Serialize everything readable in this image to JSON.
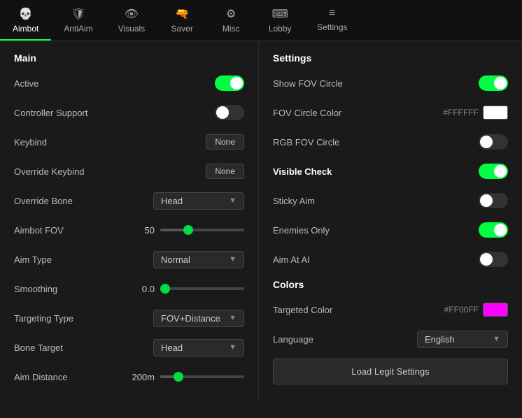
{
  "nav": {
    "items": [
      {
        "id": "aimbot",
        "label": "Aimbot",
        "icon": "💀",
        "active": true
      },
      {
        "id": "antiaim",
        "label": "AntiAim",
        "icon": "🛡",
        "active": false
      },
      {
        "id": "visuals",
        "label": "Visuals",
        "icon": "👁",
        "active": false
      },
      {
        "id": "saver",
        "label": "Saver",
        "icon": "🔫",
        "active": false
      },
      {
        "id": "misc",
        "label": "Misc",
        "icon": "⚙",
        "active": false
      },
      {
        "id": "lobby",
        "label": "Lobby",
        "icon": "⌨",
        "active": false
      },
      {
        "id": "settings",
        "label": "Settings",
        "icon": "≡",
        "active": false
      }
    ]
  },
  "left": {
    "title": "Main",
    "rows": [
      {
        "label": "Active",
        "type": "toggle",
        "state": "on"
      },
      {
        "label": "Controller Support",
        "type": "toggle",
        "state": "off"
      },
      {
        "label": "Keybind",
        "type": "keybind",
        "value": "None"
      },
      {
        "label": "Override Keybind",
        "type": "keybind",
        "value": "None"
      },
      {
        "label": "Override Bone",
        "type": "dropdown",
        "value": "Head"
      },
      {
        "label": "Aimbot FOV",
        "type": "slider",
        "numVal": "50",
        "pct": 0.33
      },
      {
        "label": "Aim Type",
        "type": "dropdown",
        "value": "Normal"
      },
      {
        "label": "Smoothing",
        "type": "slider",
        "numVal": "0.0",
        "pct": 0.0
      },
      {
        "label": "Targeting Type",
        "type": "dropdown",
        "value": "FOV+Distance"
      },
      {
        "label": "Bone Target",
        "type": "dropdown",
        "value": "Head"
      },
      {
        "label": "Aim Distance",
        "type": "slider",
        "numVal": "200m",
        "pct": 0.22
      }
    ]
  },
  "right": {
    "settings_title": "Settings",
    "settings_rows": [
      {
        "label": "Show FOV Circle",
        "type": "toggle",
        "state": "on"
      },
      {
        "label": "FOV Circle Color",
        "type": "color",
        "hex": "#FFFFFF",
        "color": "#ffffff"
      },
      {
        "label": "RGB FOV Circle",
        "type": "toggle",
        "state": "off"
      },
      {
        "label": "Visible Check",
        "type": "toggle",
        "state": "on",
        "bright": true
      },
      {
        "label": "Sticky Aim",
        "type": "toggle",
        "state": "off"
      },
      {
        "label": "Enemies Only",
        "type": "toggle",
        "state": "on"
      },
      {
        "label": "Aim At AI",
        "type": "toggle",
        "state": "off"
      }
    ],
    "colors_title": "Colors",
    "colors_rows": [
      {
        "label": "Targeted Color",
        "type": "color",
        "hex": "#FF00FF",
        "color": "#ff00ff"
      },
      {
        "label": "Language",
        "type": "dropdown",
        "value": "English"
      }
    ],
    "load_btn": "Load Legit Settings"
  }
}
